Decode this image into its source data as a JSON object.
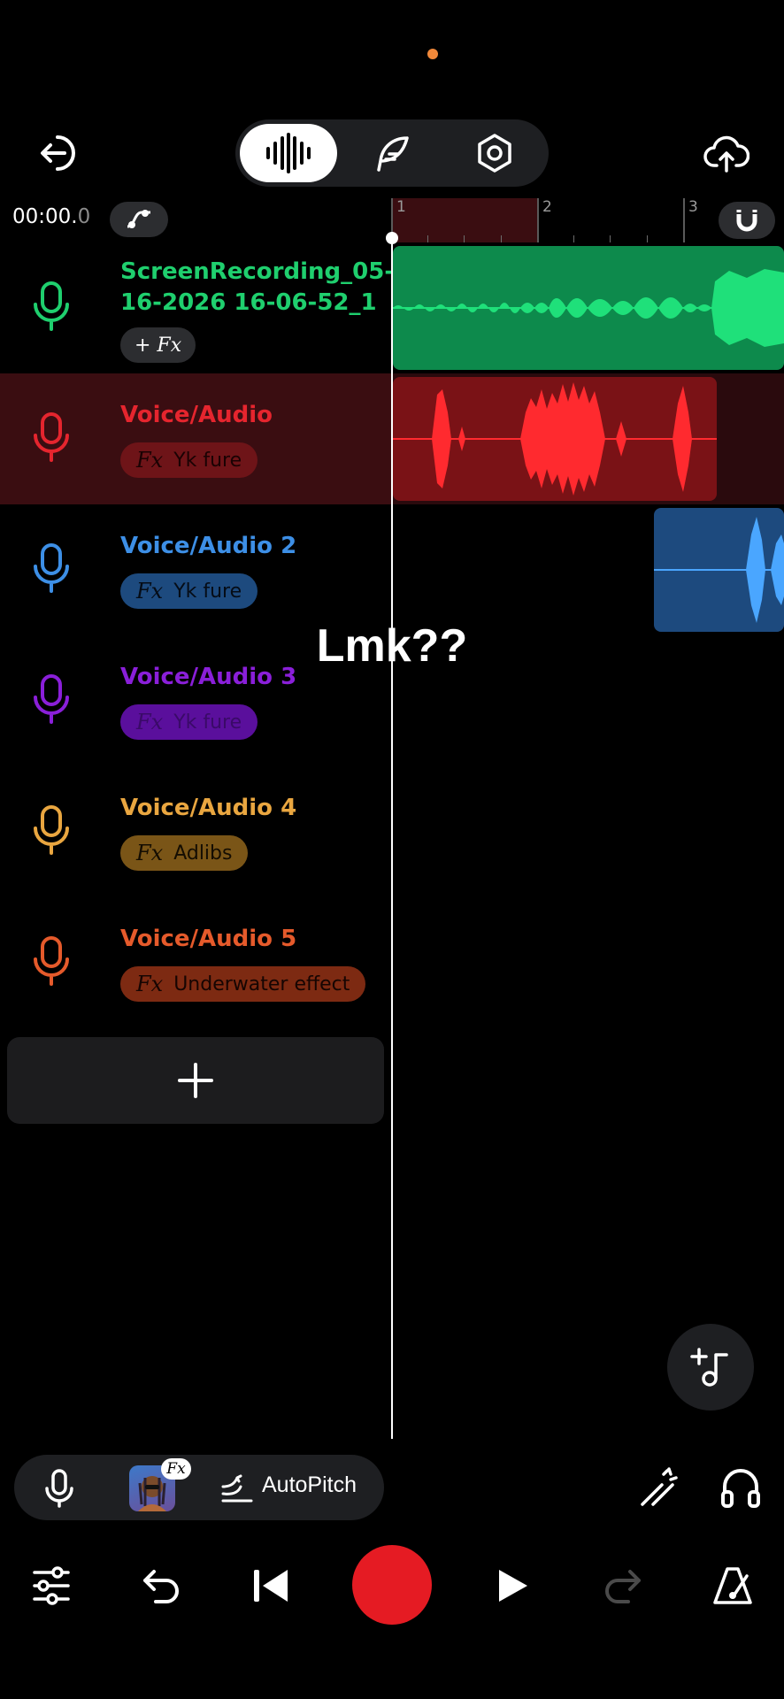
{
  "header": {
    "time_main": "00:00.",
    "time_frac": "0",
    "overlay_caption": "Lmk??"
  },
  "ruler": {
    "markers": [
      "1",
      "2",
      "3"
    ]
  },
  "tracks": [
    {
      "name_line1": "ScreenRecording_05-",
      "name_line2": "16-2026 16-06-52_1",
      "fx_label": "+ Fx",
      "color": "#1fcf6e"
    },
    {
      "name": "Voice/Audio",
      "fx_prefix": "Fx",
      "fx_label": "Yk fure",
      "color": "#e5252e"
    },
    {
      "name": "Voice/Audio 2",
      "fx_prefix": "Fx",
      "fx_label": "Yk fure",
      "color": "#3d8fe6"
    },
    {
      "name": "Voice/Audio 3",
      "fx_prefix": "Fx",
      "fx_label": "Yk fure",
      "color": "#8a1fd9"
    },
    {
      "name": "Voice/Audio 4",
      "fx_prefix": "Fx",
      "fx_label": "Adlibs",
      "color": "#e9a640"
    },
    {
      "name": "Voice/Audio 5",
      "fx_prefix": "Fx",
      "fx_label": "Underwater effect",
      "color": "#e55a2b"
    }
  ],
  "toolbar": {
    "fx_badge": "Fx",
    "autopitch_label": "AutoPitch"
  },
  "icons": {
    "exit": "exit-icon",
    "waveform_mode": "waveform-icon",
    "feather_mode": "feather-icon",
    "settings_mode": "hexagon-settings-icon",
    "upload": "cloud-upload-icon",
    "automation": "automation-curve-icon",
    "magnet": "magnet-icon",
    "add_music": "add-music-icon"
  }
}
